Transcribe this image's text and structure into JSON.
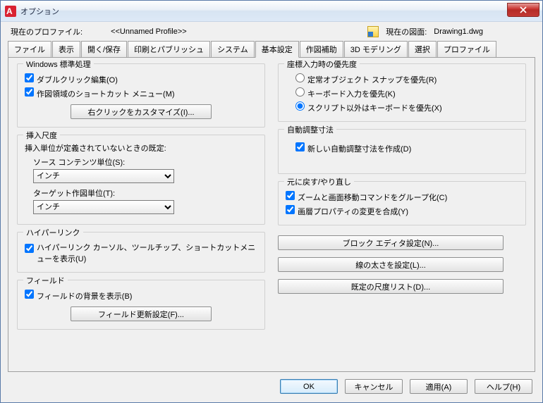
{
  "window": {
    "title": "オプション"
  },
  "profile": {
    "label": "現在のプロファイル:",
    "value": "<<Unnamed Profile>>",
    "drawing_label": "現在の図面:",
    "drawing_value": "Drawing1.dwg"
  },
  "tabs": [
    "ファイル",
    "表示",
    "開く/保存",
    "印刷とパブリッシュ",
    "システム",
    "基本設定",
    "作図補助",
    "3D モデリング",
    "選択",
    "プロファイル"
  ],
  "active_tab_index": 5,
  "left": {
    "win": {
      "legend": "Windows 標準処理",
      "dbl_click": "ダブルクリック編集(O)",
      "shortcut_menu": "作図領域のショートカット メニュー(M)",
      "btn_rclick": "右クリックをカスタマイズ(I)..."
    },
    "scale": {
      "legend": "挿入尺度",
      "desc": "挿入単位が定義されていないときの既定:",
      "src_label": "ソース コンテンツ単位(S):",
      "tgt_label": "ターゲット作図単位(T):",
      "options": [
        "インチ"
      ],
      "src_value": "インチ",
      "tgt_value": "インチ"
    },
    "hyper": {
      "legend": "ハイパーリンク",
      "chk": "ハイパーリンク カーソル、ツールチップ、ショートカットメニューを表示(U)"
    },
    "field": {
      "legend": "フィールド",
      "chk": "フィールドの背景を表示(B)",
      "btn": "フィールド更新設定(F)..."
    }
  },
  "right": {
    "coord": {
      "legend": "座標入力時の優先度",
      "r1": "定常オブジェクト スナップを優先(R)",
      "r2": "キーボード入力を優先(K)",
      "r3": "スクリプト以外はキーボードを優先(X)"
    },
    "autodim": {
      "legend": "自動調整寸法",
      "chk": "新しい自動調整寸法を作成(D)"
    },
    "undo": {
      "legend": "元に戻す/やり直し",
      "c1": "ズームと画面移動コマンドをグループ化(C)",
      "c2": "画層プロパティの変更を合成(Y)"
    },
    "btn1": "ブロック エディタ設定(N)...",
    "btn2": "線の太さを設定(L)...",
    "btn3": "既定の尺度リスト(D)..."
  },
  "footer": {
    "ok": "OK",
    "cancel": "キャンセル",
    "apply": "適用(A)",
    "help": "ヘルプ(H)"
  }
}
